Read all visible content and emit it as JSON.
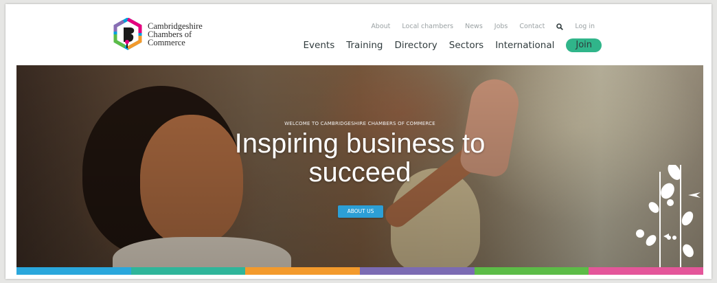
{
  "logo": {
    "line1": "Cambridgeshire",
    "line2": "Chambers of",
    "line3": "Commerce"
  },
  "utility_nav": {
    "about": "About",
    "local_chambers": "Local chambers",
    "news": "News",
    "jobs": "Jobs",
    "contact": "Contact",
    "log_in": "Log in"
  },
  "main_nav": {
    "events": "Events",
    "training": "Training",
    "directory": "Directory",
    "sectors": "Sectors",
    "international": "International",
    "join": "Join"
  },
  "hero": {
    "kicker": "WELCOME TO CAMBRIDGESHIRE CHAMBERS OF COMMERCE",
    "headline_line1": "Inspiring business to",
    "headline_line2": "succeed",
    "cta": "ABOUT US"
  },
  "colors": {
    "accent_green": "#30b58a",
    "button_blue": "#2c9fd6",
    "strip": [
      "#2aa7dc",
      "#2fb59a",
      "#f39a2c",
      "#7b6bb3",
      "#5cbc47",
      "#e4569a"
    ]
  },
  "icons": [
    "search-icon",
    "logo-mark-icon",
    "vine-graphic-icon"
  ]
}
